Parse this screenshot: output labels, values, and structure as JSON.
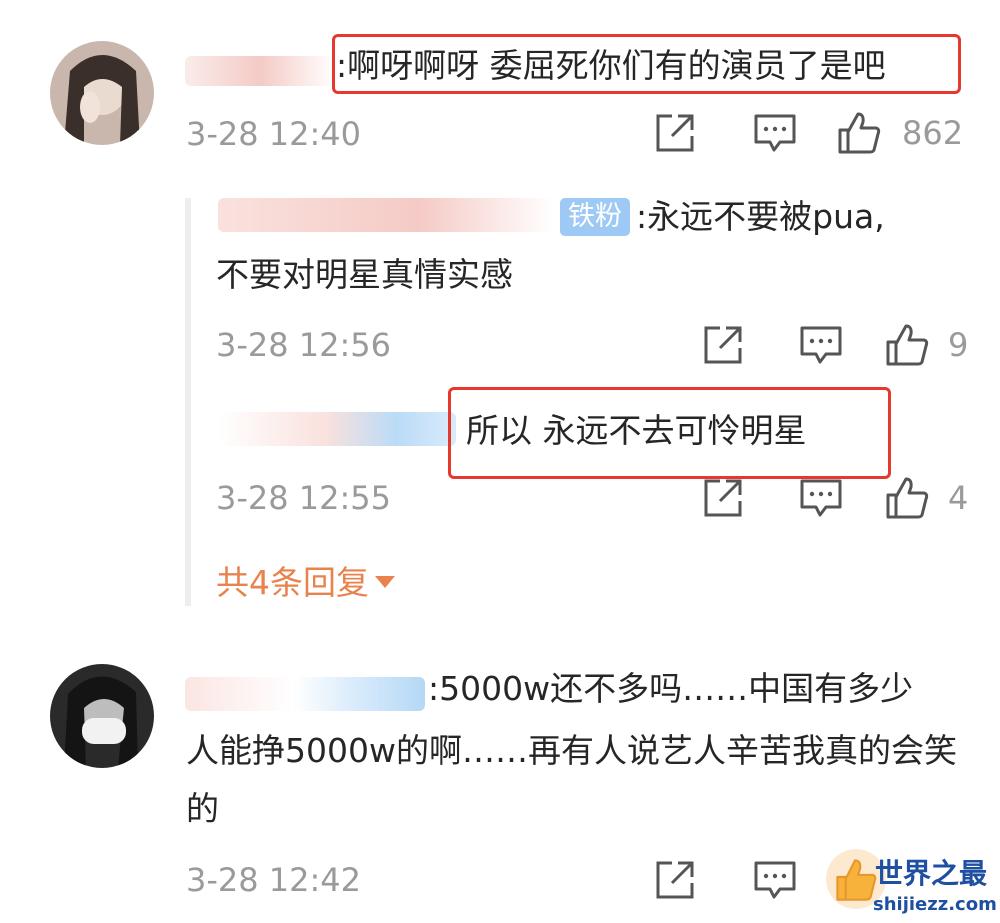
{
  "comments": [
    {
      "text": ":啊呀啊呀 委屈死你们有的演员了是吧",
      "time": "3-28 12:40",
      "likes": "862"
    },
    {
      "text_line1": ":5000w还不多吗……中国有多少",
      "text_rest": "人能挣5000w的啊……再有人说艺人辛苦我真的会笑的",
      "time": "3-28 12:42"
    }
  ],
  "replies": [
    {
      "badge": "铁粉",
      "text_line1": ":永远不要被pua,",
      "text_line2": "不要对明星真情实感",
      "time": "3-28 12:56",
      "likes": "9"
    },
    {
      "text": "所以 永远不去可怜明星",
      "time": "3-28 12:55",
      "likes": "4"
    }
  ],
  "more_replies_label": "共4条回复",
  "watermark": {
    "title": "世界之最",
    "url": "shijiezz.com"
  },
  "colors": {
    "highlight_box": "#e5392d",
    "link_orange": "#e8834e",
    "meta_gray": "#9a9a9a",
    "badge_blue": "#9ec9f5"
  }
}
